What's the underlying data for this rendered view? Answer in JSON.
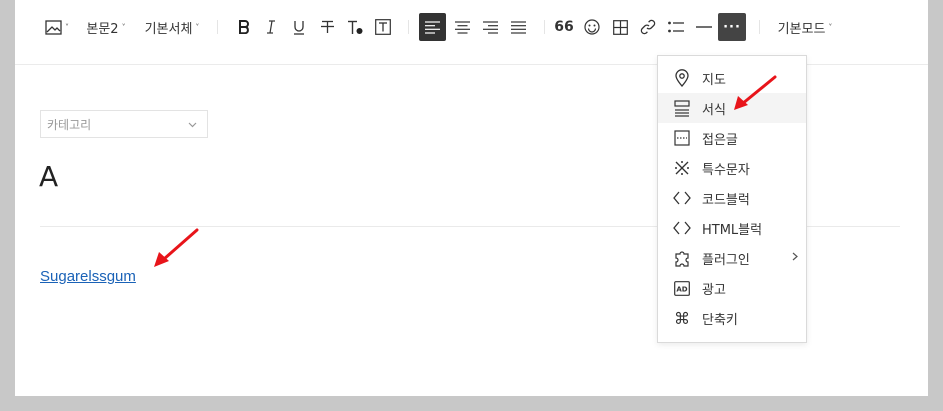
{
  "toolbar": {
    "image_caret": "˅",
    "paragraph_style": "본문2",
    "font_family": "기본서체",
    "quote_glyph": "66",
    "more_glyph": "···",
    "mode": "기본모드"
  },
  "category": {
    "placeholder": "카테고리"
  },
  "post": {
    "title": "A",
    "link_text": "Sugarelssgum"
  },
  "more_menu": {
    "items": [
      {
        "label": "지도",
        "icon": "map-pin-icon"
      },
      {
        "label": "서식",
        "icon": "template-icon"
      },
      {
        "label": "접은글",
        "icon": "fold-icon"
      },
      {
        "label": "특수문자",
        "icon": "special-char-icon"
      },
      {
        "label": "코드블럭",
        "icon": "code-icon"
      },
      {
        "label": "HTML블럭",
        "icon": "html-icon"
      },
      {
        "label": "플러그인",
        "icon": "plugin-icon"
      },
      {
        "label": "광고",
        "icon": "ad-icon"
      },
      {
        "label": "단축키",
        "icon": "command-icon"
      }
    ],
    "highlighted_index": 1
  },
  "annotation_color": "#e8141a"
}
